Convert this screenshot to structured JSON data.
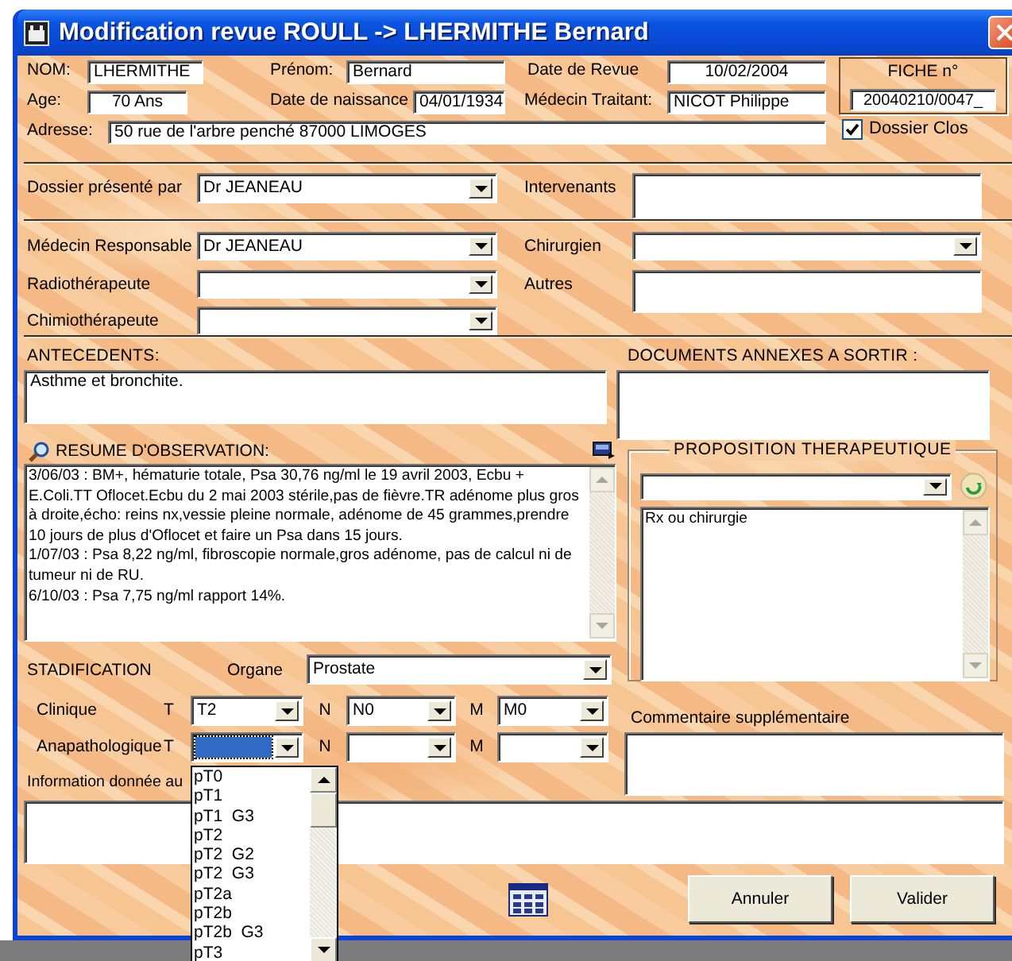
{
  "window": {
    "title": "Modification revue ROULL -> LHERMITHE Bernard"
  },
  "patient": {
    "nom_label": "NOM:",
    "nom": "LHERMITHE",
    "prenom_label": "Prénom:",
    "prenom": "Bernard",
    "date_revue_label": "Date de Revue",
    "date_revue": "10/02/2004",
    "age_label": "Age:",
    "age": "70 Ans",
    "naissance_label": "Date de naissance",
    "naissance": "04/01/1934",
    "medecin_traitant_label": "Médecin Traitant:",
    "medecin_traitant": "NICOT Philippe",
    "adresse_label": "Adresse:",
    "adresse": "50 rue de l'arbre penché  87000 LIMOGES"
  },
  "fiche": {
    "label": "FICHE n°",
    "number": "20040210/0047_"
  },
  "dossier_clos": {
    "label": "Dossier Clos",
    "checked": true
  },
  "presentation": {
    "presente_par_label": "Dossier présenté par",
    "presente_par": "Dr JEANEAU",
    "intervenants_label": "Intervenants"
  },
  "medecins": {
    "responsable_label": "Médecin Responsable",
    "responsable": "Dr JEANEAU",
    "chirurgien_label": "Chirurgien",
    "radio_label": "Radiothérapeute",
    "autres_label": "Autres",
    "chimio_label": "Chimiothérapeute"
  },
  "antecedents": {
    "label": "ANTECEDENTS:",
    "text": "Asthme et bronchite."
  },
  "documents": {
    "label": "DOCUMENTS ANNEXES A SORTIR :"
  },
  "observation": {
    "label": "RESUME D'OBSERVATION:",
    "text": "3/06/03 : BM+, hématurie totale, Psa 30,76 ng/ml le 19 avril 2003, Ecbu + E.Coli.TT Oflocet.Ecbu du 2 mai 2003 stérile,pas de fièvre.TR adénome plus gros à droite,écho: reins nx,vessie pleine normale, adénome de 45 grammes,prendre 10 jours de plus d'Oflocet et faire un Psa dans 15 jours.\n1/07/03 : Psa 8,22 ng/ml, fibroscopie normale,gros adénome, pas de calcul ni de tumeur ni de RU.\n6/10/03 : Psa 7,75 ng/ml rapport 14%."
  },
  "proposition": {
    "title": "PROPOSITION THERAPEUTIQUE",
    "text": "Rx ou chirurgie"
  },
  "stadification": {
    "label": "STADIFICATION",
    "organe_label": "Organe",
    "organe": "Prostate",
    "rows": [
      {
        "label": "Clinique",
        "t_label": "T",
        "t": "T2",
        "n_label": "N",
        "n": "N0",
        "m_label": "M",
        "m": "M0",
        "t_focused": false
      },
      {
        "label": "Anapathologique",
        "t_label": "T",
        "n_label": "N",
        "m_label": "M",
        "t_focused": true,
        "t_options": [
          "pT0",
          "pT1",
          "pT1  G3",
          "pT2",
          "pT2  G2",
          "pT2  G3",
          "pT2a",
          "pT2b",
          "pT2b  G3",
          "pT3"
        ]
      }
    ]
  },
  "commentaire": {
    "label": "Commentaire supplémentaire"
  },
  "information": {
    "label": "Information donnée au"
  },
  "buttons": [
    {
      "label": "Annuler"
    },
    {
      "label": "Valider"
    }
  ]
}
